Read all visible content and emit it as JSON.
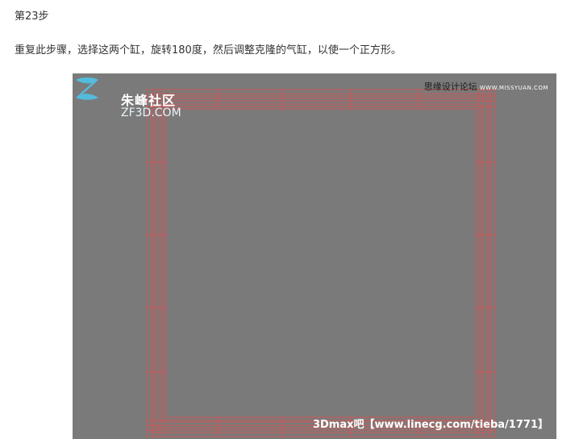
{
  "step": {
    "title": "第23步",
    "text": "重复此步骤，选择这两个缸，旋转180度，然后调整克隆的气缸，以使一个正方形。"
  },
  "figure": {
    "logo_cn": "朱峰社区",
    "logo_en": "ZF3D.COM",
    "watermark_top": "思缘设计论坛",
    "watermark_top_url": "WWW.MISSYUAN.COM",
    "watermark_bottom": "3Dmax吧【www.linecg.com/tieba/1771】",
    "background_color": "#7a7a7a",
    "wireframe_color": "#e05050",
    "logo_color": "#4fc3e8"
  }
}
